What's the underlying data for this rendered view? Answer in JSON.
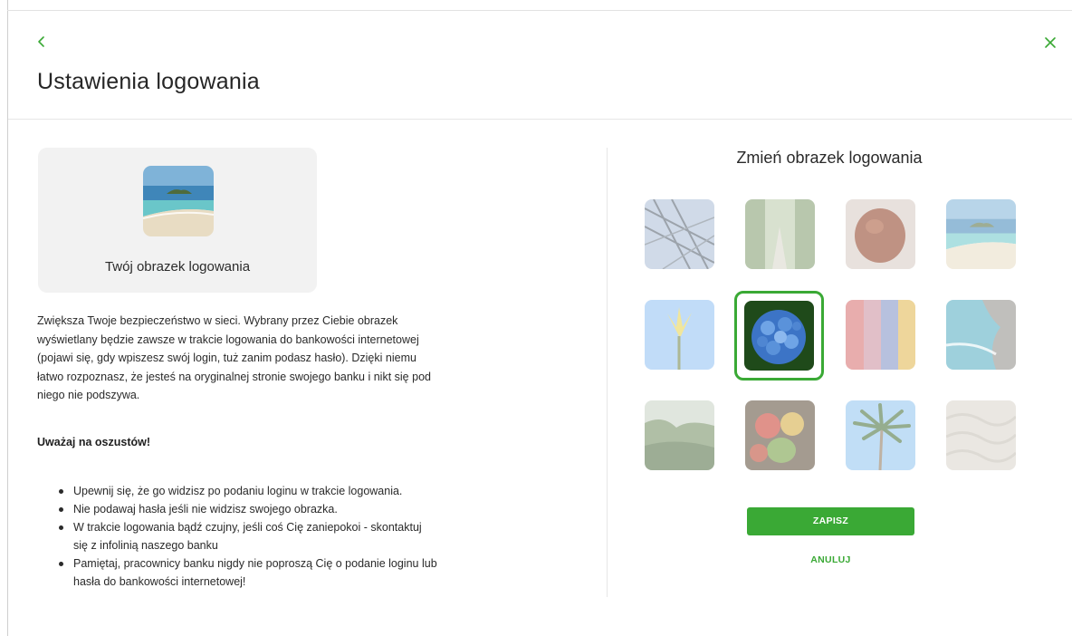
{
  "header": {
    "title": "Ustawienia logowania",
    "back_icon": "chevron-left-icon",
    "close_icon": "close-icon",
    "accent_color": "#3aa935"
  },
  "current_image": {
    "label": "Twój obrazek logowania",
    "image": "beach-island"
  },
  "description": "Zwiększa Twoje bezpieczeństwo w sieci. Wybrany przez Ciebie obrazek wyświetlany będzie zawsze w trakcie logowania do bankowości internetowej (pojawi się, gdy wpiszesz swój login, tuż zanim podasz hasło). Dzięki niemu łatwo rozpoznasz, że jesteś na oryginalnej stronie swojego banku i nikt się pod niego nie podszywa.",
  "warning": {
    "title": "Uważaj na oszustów!",
    "tips": [
      "Upewnij się, że go widzisz po podaniu loginu w trakcie logowania.",
      "Nie podawaj hasła jeśli nie widzisz swojego obrazka.",
      "W trakcie logowania bądź czujny, jeśli coś Cię zaniepokoi - skontaktuj się z infolinią naszego banku",
      "Pamiętaj, pracownicy banku nigdy nie poproszą Cię o podanie loginu lub hasła do bankowości internetowej!"
    ]
  },
  "gallery": {
    "title": "Zmień obrazek logowania",
    "images": [
      "glass-roof",
      "forest-path",
      "coconut",
      "beach-island",
      "yellow-flower",
      "blue-hydrangea",
      "colored-stripes",
      "rocky-coast",
      "misty-forest",
      "vegetables",
      "palm-tree",
      "sand-texture"
    ],
    "selected_index": 5
  },
  "actions": {
    "save_label": "ZAPISZ",
    "cancel_label": "ANULUJ"
  }
}
